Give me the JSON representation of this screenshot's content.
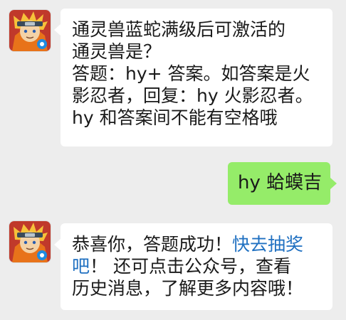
{
  "chat": {
    "messages": [
      {
        "sender": "official-account",
        "lines": [
          "通灵兽蓝蛇满级后可激活的",
          "通灵兽是？",
          "答题：hy+ 答案。如答案是火",
          "影忍者，回复：hy 火影忍者。",
          "hy 和答案间不能有空格哦"
        ]
      },
      {
        "sender": "user",
        "text": "hy 蛤蟆吉"
      },
      {
        "sender": "official-account",
        "line1_prefix": "恭喜你，答题成功！",
        "line1_link": "快去抽奖",
        "line2_link": "吧",
        "line2_rest": "！ 还可点击公众号，查看",
        "line3": "历史消息，了解更多内容哦！"
      }
    ]
  },
  "colors": {
    "background": "#ededed",
    "incoming_bubble": "#ffffff",
    "outgoing_bubble": "#95ec69",
    "link": "#1f70c1"
  },
  "icons": {
    "avatar": "anime-character-avatar-icon"
  }
}
